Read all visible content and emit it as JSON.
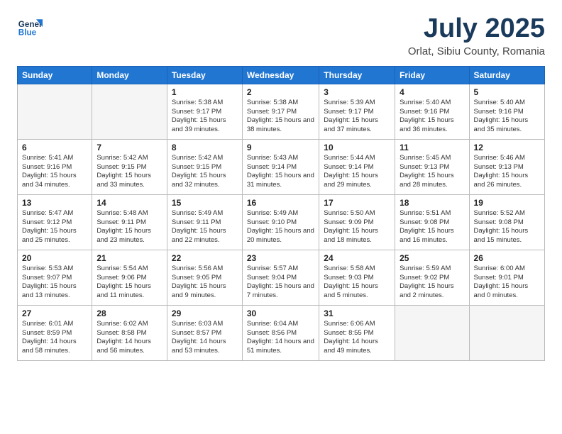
{
  "header": {
    "logo_line1": "General",
    "logo_line2": "Blue",
    "month": "July 2025",
    "location": "Orlat, Sibiu County, Romania"
  },
  "weekdays": [
    "Sunday",
    "Monday",
    "Tuesday",
    "Wednesday",
    "Thursday",
    "Friday",
    "Saturday"
  ],
  "weeks": [
    [
      {
        "day": "",
        "info": ""
      },
      {
        "day": "",
        "info": ""
      },
      {
        "day": "1",
        "info": "Sunrise: 5:38 AM\nSunset: 9:17 PM\nDaylight: 15 hours\nand 39 minutes."
      },
      {
        "day": "2",
        "info": "Sunrise: 5:38 AM\nSunset: 9:17 PM\nDaylight: 15 hours\nand 38 minutes."
      },
      {
        "day": "3",
        "info": "Sunrise: 5:39 AM\nSunset: 9:17 PM\nDaylight: 15 hours\nand 37 minutes."
      },
      {
        "day": "4",
        "info": "Sunrise: 5:40 AM\nSunset: 9:16 PM\nDaylight: 15 hours\nand 36 minutes."
      },
      {
        "day": "5",
        "info": "Sunrise: 5:40 AM\nSunset: 9:16 PM\nDaylight: 15 hours\nand 35 minutes."
      }
    ],
    [
      {
        "day": "6",
        "info": "Sunrise: 5:41 AM\nSunset: 9:16 PM\nDaylight: 15 hours\nand 34 minutes."
      },
      {
        "day": "7",
        "info": "Sunrise: 5:42 AM\nSunset: 9:15 PM\nDaylight: 15 hours\nand 33 minutes."
      },
      {
        "day": "8",
        "info": "Sunrise: 5:42 AM\nSunset: 9:15 PM\nDaylight: 15 hours\nand 32 minutes."
      },
      {
        "day": "9",
        "info": "Sunrise: 5:43 AM\nSunset: 9:14 PM\nDaylight: 15 hours\nand 31 minutes."
      },
      {
        "day": "10",
        "info": "Sunrise: 5:44 AM\nSunset: 9:14 PM\nDaylight: 15 hours\nand 29 minutes."
      },
      {
        "day": "11",
        "info": "Sunrise: 5:45 AM\nSunset: 9:13 PM\nDaylight: 15 hours\nand 28 minutes."
      },
      {
        "day": "12",
        "info": "Sunrise: 5:46 AM\nSunset: 9:13 PM\nDaylight: 15 hours\nand 26 minutes."
      }
    ],
    [
      {
        "day": "13",
        "info": "Sunrise: 5:47 AM\nSunset: 9:12 PM\nDaylight: 15 hours\nand 25 minutes."
      },
      {
        "day": "14",
        "info": "Sunrise: 5:48 AM\nSunset: 9:11 PM\nDaylight: 15 hours\nand 23 minutes."
      },
      {
        "day": "15",
        "info": "Sunrise: 5:49 AM\nSunset: 9:11 PM\nDaylight: 15 hours\nand 22 minutes."
      },
      {
        "day": "16",
        "info": "Sunrise: 5:49 AM\nSunset: 9:10 PM\nDaylight: 15 hours\nand 20 minutes."
      },
      {
        "day": "17",
        "info": "Sunrise: 5:50 AM\nSunset: 9:09 PM\nDaylight: 15 hours\nand 18 minutes."
      },
      {
        "day": "18",
        "info": "Sunrise: 5:51 AM\nSunset: 9:08 PM\nDaylight: 15 hours\nand 16 minutes."
      },
      {
        "day": "19",
        "info": "Sunrise: 5:52 AM\nSunset: 9:08 PM\nDaylight: 15 hours\nand 15 minutes."
      }
    ],
    [
      {
        "day": "20",
        "info": "Sunrise: 5:53 AM\nSunset: 9:07 PM\nDaylight: 15 hours\nand 13 minutes."
      },
      {
        "day": "21",
        "info": "Sunrise: 5:54 AM\nSunset: 9:06 PM\nDaylight: 15 hours\nand 11 minutes."
      },
      {
        "day": "22",
        "info": "Sunrise: 5:56 AM\nSunset: 9:05 PM\nDaylight: 15 hours\nand 9 minutes."
      },
      {
        "day": "23",
        "info": "Sunrise: 5:57 AM\nSunset: 9:04 PM\nDaylight: 15 hours\nand 7 minutes."
      },
      {
        "day": "24",
        "info": "Sunrise: 5:58 AM\nSunset: 9:03 PM\nDaylight: 15 hours\nand 5 minutes."
      },
      {
        "day": "25",
        "info": "Sunrise: 5:59 AM\nSunset: 9:02 PM\nDaylight: 15 hours\nand 2 minutes."
      },
      {
        "day": "26",
        "info": "Sunrise: 6:00 AM\nSunset: 9:01 PM\nDaylight: 15 hours\nand 0 minutes."
      }
    ],
    [
      {
        "day": "27",
        "info": "Sunrise: 6:01 AM\nSunset: 8:59 PM\nDaylight: 14 hours\nand 58 minutes."
      },
      {
        "day": "28",
        "info": "Sunrise: 6:02 AM\nSunset: 8:58 PM\nDaylight: 14 hours\nand 56 minutes."
      },
      {
        "day": "29",
        "info": "Sunrise: 6:03 AM\nSunset: 8:57 PM\nDaylight: 14 hours\nand 53 minutes."
      },
      {
        "day": "30",
        "info": "Sunrise: 6:04 AM\nSunset: 8:56 PM\nDaylight: 14 hours\nand 51 minutes."
      },
      {
        "day": "31",
        "info": "Sunrise: 6:06 AM\nSunset: 8:55 PM\nDaylight: 14 hours\nand 49 minutes."
      },
      {
        "day": "",
        "info": ""
      },
      {
        "day": "",
        "info": ""
      }
    ]
  ]
}
